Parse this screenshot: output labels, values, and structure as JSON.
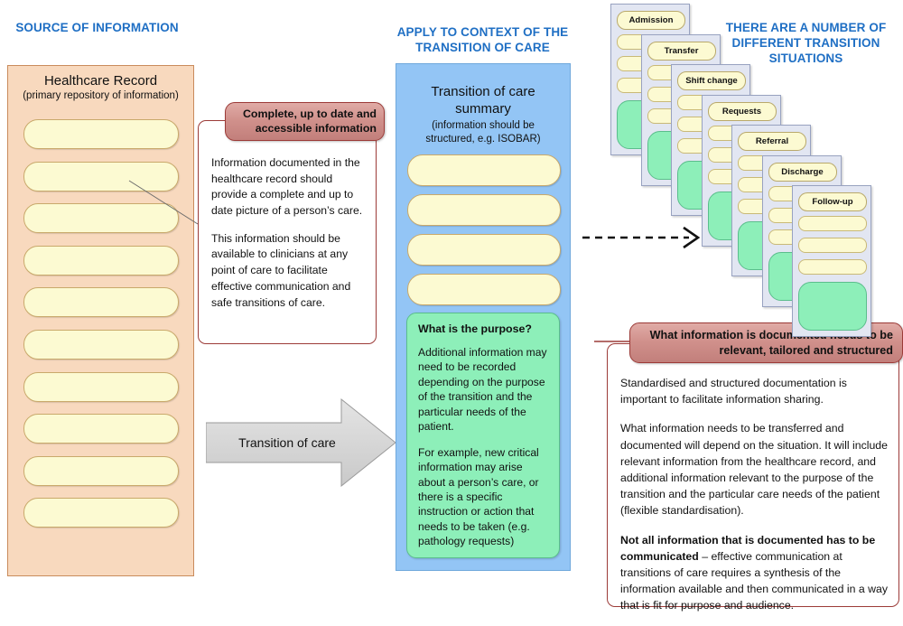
{
  "headings": {
    "source": "SOURCE OF INFORMATION",
    "apply": "APPLY TO CONTEXT OF THE TRANSITION OF CARE",
    "situations": "THERE ARE A NUMBER OF DIFFERENT TRANSITION SITUATIONS"
  },
  "healthcare_record": {
    "title": "Healthcare Record",
    "subtitle": "(primary repository of information)",
    "bar_count": 10
  },
  "callout_left": {
    "header": "Complete, up to date and accessible information",
    "paragraphs": [
      "Information documented in the healthcare record should provide a complete and up to date picture of a person’s care.",
      "This information should be available to clinicians at any point of care to facilitate effective communication and safe transitions of care."
    ]
  },
  "transition_arrow": {
    "label": "Transition of care"
  },
  "transition_summary": {
    "title_line1": "Transition of care",
    "title_line2": "summary",
    "subtitle_line1": "(information should be",
    "subtitle_line2": "structured, e.g. ISOBAR)",
    "bar_count": 4,
    "purpose": {
      "title": "What is the purpose?",
      "paragraphs": [
        "Additional information may need to be recorded depending on the purpose of the transition and the particular needs of the patient.",
        "For example, new critical information may arise about a person’s care, or there is a specific instruction or action that needs to be taken (e.g. pathology requests)"
      ]
    }
  },
  "transition_cards": [
    {
      "label": "Admission"
    },
    {
      "label": "Transfer"
    },
    {
      "label": "Shift change"
    },
    {
      "label": "Requests"
    },
    {
      "label": "Referral"
    },
    {
      "label": "Discharge"
    },
    {
      "label": "Follow-up"
    }
  ],
  "callout_right": {
    "header": "What information is documented needs to be relevant, tailored and structured",
    "paragraph1": "Standardised and structured documentation is important to facilitate information sharing.",
    "paragraph2": "What information needs to be transferred and documented will depend on the situation. It will include relevant information from the healthcare record, and additional information relevant to the purpose of the transition and the particular care needs of the patient (flexible standardisation).",
    "paragraph3_bold": "Not all information that is documented has to be communicated",
    "paragraph3_rest": " – effective communication at transitions of care requires a synthesis of the information available and then communicated in a way that is fit for purpose and audience."
  },
  "colors": {
    "heading_blue": "#1F6FC4",
    "record_peach": "#F8D9BE",
    "bar_yellow": "#FCFAD2",
    "summary_blue": "#93C5F5",
    "purpose_green": "#8DEFB9",
    "callout_red": "#9C3B38",
    "callout_header_pink": "#D0908B",
    "card_lavender": "#E2E6F2",
    "arrow_grey": "#D4D4D4"
  }
}
